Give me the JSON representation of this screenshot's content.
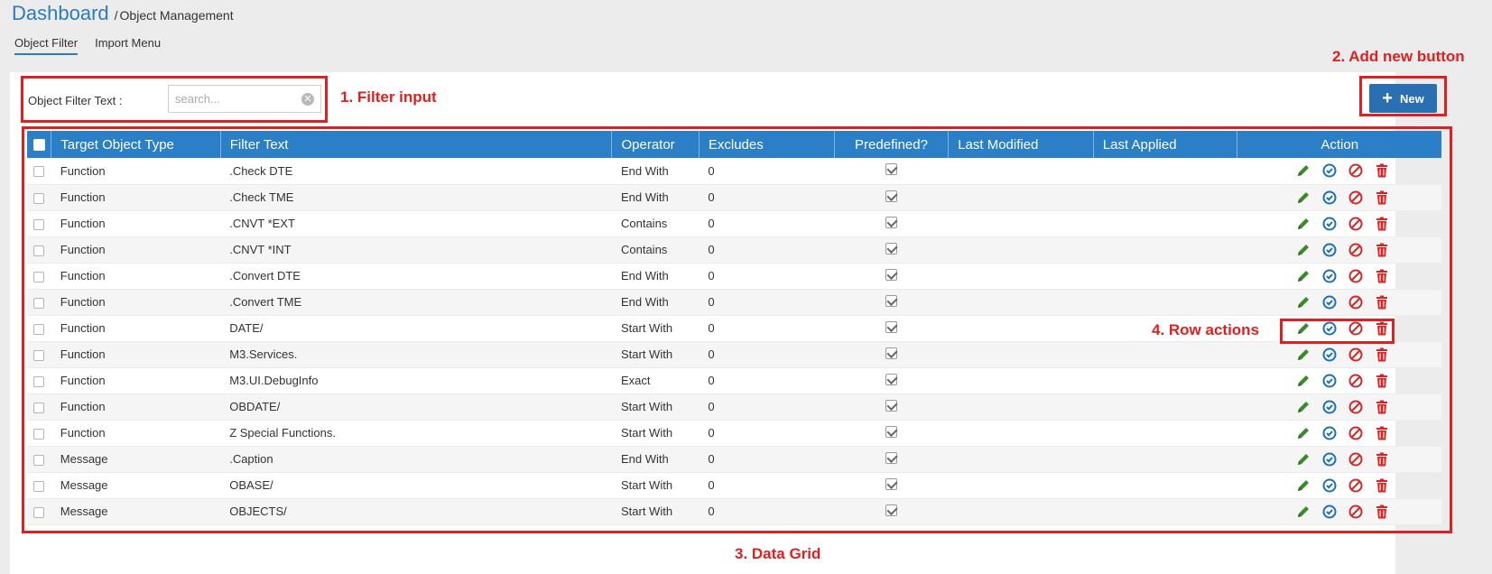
{
  "breadcrumb": {
    "home": "Dashboard",
    "separator": "/",
    "current": "Object Management"
  },
  "tabs": [
    {
      "label": "Object Filter",
      "active": true
    },
    {
      "label": "Import Menu",
      "active": false
    }
  ],
  "filter": {
    "label": "Object Filter Text :",
    "placeholder": "search...",
    "value": ""
  },
  "new_button": {
    "label": "New",
    "icon": "plus-icon"
  },
  "annotations": {
    "filter_input": "1. Filter input",
    "add_new": "2. Add new button",
    "data_grid": "3. Data Grid",
    "row_actions": "4. Row actions"
  },
  "columns": [
    "Target Object Type",
    "Filter Text",
    "Operator",
    "Excludes",
    "Predefined?",
    "Last Modified",
    "Last Applied",
    "Action"
  ],
  "rows": [
    {
      "type": "Function",
      "filter": ".Check DTE",
      "operator": "End With",
      "excludes": "0",
      "predefined": true,
      "modified": "",
      "applied": ""
    },
    {
      "type": "Function",
      "filter": ".Check TME",
      "operator": "End With",
      "excludes": "0",
      "predefined": true,
      "modified": "",
      "applied": ""
    },
    {
      "type": "Function",
      "filter": ".CNVT *EXT",
      "operator": "Contains",
      "excludes": "0",
      "predefined": true,
      "modified": "",
      "applied": ""
    },
    {
      "type": "Function",
      "filter": ".CNVT *INT",
      "operator": "Contains",
      "excludes": "0",
      "predefined": true,
      "modified": "",
      "applied": ""
    },
    {
      "type": "Function",
      "filter": ".Convert DTE",
      "operator": "End With",
      "excludes": "0",
      "predefined": true,
      "modified": "",
      "applied": ""
    },
    {
      "type": "Function",
      "filter": ".Convert TME",
      "operator": "End With",
      "excludes": "0",
      "predefined": true,
      "modified": "",
      "applied": ""
    },
    {
      "type": "Function",
      "filter": "DATE/",
      "operator": "Start With",
      "excludes": "0",
      "predefined": true,
      "modified": "",
      "applied": ""
    },
    {
      "type": "Function",
      "filter": "M3.Services.",
      "operator": "Start With",
      "excludes": "0",
      "predefined": true,
      "modified": "",
      "applied": ""
    },
    {
      "type": "Function",
      "filter": "M3.UI.DebugInfo",
      "operator": "Exact",
      "excludes": "0",
      "predefined": true,
      "modified": "",
      "applied": ""
    },
    {
      "type": "Function",
      "filter": "OBDATE/",
      "operator": "Start With",
      "excludes": "0",
      "predefined": true,
      "modified": "",
      "applied": ""
    },
    {
      "type": "Function",
      "filter": "Z Special Functions.",
      "operator": "Start With",
      "excludes": "0",
      "predefined": true,
      "modified": "",
      "applied": ""
    },
    {
      "type": "Message",
      "filter": ".Caption",
      "operator": "End With",
      "excludes": "0",
      "predefined": true,
      "modified": "",
      "applied": ""
    },
    {
      "type": "Message",
      "filter": "OBASE/",
      "operator": "Start With",
      "excludes": "0",
      "predefined": true,
      "modified": "",
      "applied": ""
    },
    {
      "type": "Message",
      "filter": "OBJECTS/",
      "operator": "Start With",
      "excludes": "0",
      "predefined": true,
      "modified": "",
      "applied": ""
    }
  ],
  "row_action_icons": [
    "edit-icon",
    "apply-icon",
    "disable-icon",
    "delete-icon"
  ],
  "colors": {
    "accent": "#2a7fc7",
    "button": "#2a6fb1",
    "edit": "#3a8a2a",
    "apply": "#1d6fb8",
    "disable": "#d02a2a",
    "delete": "#e02020",
    "annotation": "#e02020"
  }
}
